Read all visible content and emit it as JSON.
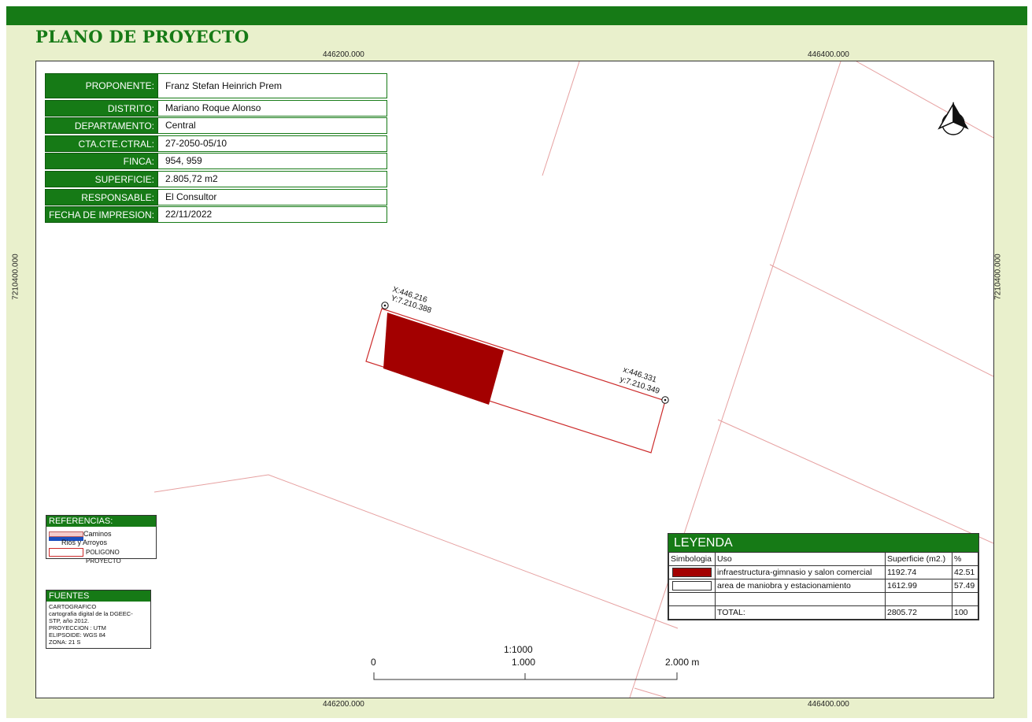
{
  "title": "PLANO DE PROYECTO",
  "grid_coords": {
    "x_left": "446200.000",
    "x_right": "446400.000",
    "y_mid": "7210400.000"
  },
  "info_table": [
    {
      "label": "PROPONENTE:",
      "value": "Franz Stefan Heinrich Prem"
    },
    {
      "label": "DISTRITO:",
      "value": "Mariano Roque Alonso"
    },
    {
      "label": "DEPARTAMENTO:",
      "value": "Central"
    },
    {
      "label": "CTA.CTE.CTRAL:",
      "value": "27-2050-05/10"
    },
    {
      "label": "FINCA:",
      "value": "954, 959"
    },
    {
      "label": "SUPERFICIE:",
      "value": "2.805,72 m2"
    },
    {
      "label": "RESPONSABLE:",
      "value": "El Consultor"
    },
    {
      "label": "FECHA DE IMPRESION:",
      "value": "22/11/2022"
    }
  ],
  "points": [
    {
      "x": "X:446.216",
      "y": "Y:7.210.388"
    },
    {
      "x": "x:446.331",
      "y": "y:7.210.349"
    }
  ],
  "referencias": {
    "title": "REFERENCIAS:",
    "items": [
      "Caminos",
      "Rios y Arroyos",
      "POLIGONO PROYECTO"
    ]
  },
  "fuentes": {
    "title": "FUENTES",
    "text": "CARTOGRAFICO\ncartografia digital de la DGEEC-\nSTP, año 2012.\nPROYECCION : UTM\nELIPSOIDE: WGS 84\nZONA: 21 S"
  },
  "leyenda": {
    "title": "LEYENDA",
    "headers": [
      "Simbologia",
      "Uso",
      "Superficie (m2.)",
      "%"
    ],
    "rows": [
      {
        "color": "#a30000",
        "uso": "infraestructura-gimnasio y salon comercial",
        "superficie": "1192.74",
        "pct": "42.51"
      },
      {
        "color": "#ffffff",
        "uso": "area de maniobra y estacionamiento",
        "superficie": "1612.99",
        "pct": "57.49"
      }
    ],
    "total_label": "TOTAL:",
    "total_superficie": "2805.72",
    "total_pct": "100"
  },
  "scale": {
    "ratio": "1:1000",
    "labels": [
      "0",
      "1.000",
      "2.000 m"
    ]
  },
  "colors": {
    "brand": "#167a16",
    "building": "#a30000",
    "roads": "#e6a0a0",
    "rivers": "#1a4fbf",
    "polygon": "#cc2a2a"
  },
  "north_arrow_icon": "north-arrow-icon"
}
